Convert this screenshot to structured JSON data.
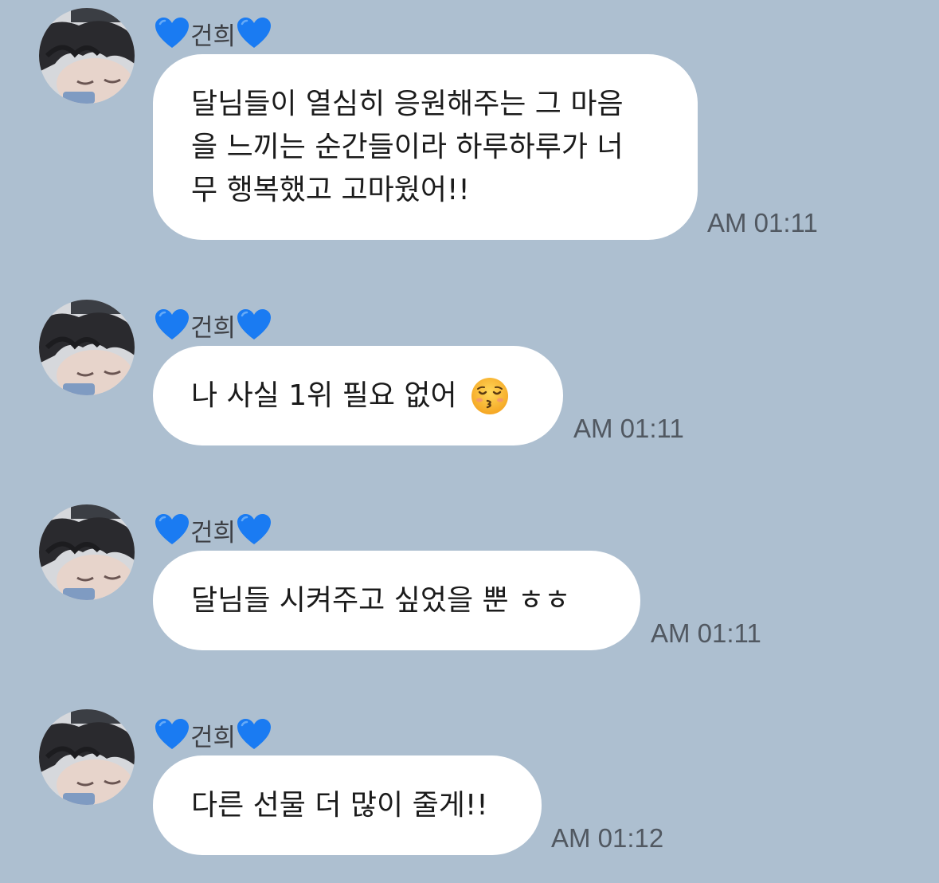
{
  "messages": [
    {
      "sender": "건희",
      "sender_icon": "blue-heart-emoji",
      "text": "달님들이 열심히 응원해주는 그 마음\n을 느끼는 순간들이라 하루하루가 너\n무 행복했고 고마웠어!!",
      "time": "AM 01:11"
    },
    {
      "sender": "건희",
      "sender_icon": "blue-heart-emoji",
      "text": "나 사실 1위 필요 없어",
      "emoji": "kissing-face-with-closed-eyes-emoji",
      "time": "AM 01:11"
    },
    {
      "sender": "건희",
      "sender_icon": "blue-heart-emoji",
      "text": "달님들 시켜주고 싶었을 뿐 ㅎㅎ",
      "time": "AM 01:11"
    },
    {
      "sender": "건희",
      "sender_icon": "blue-heart-emoji",
      "text": "다른 선물 더 많이 줄게!!",
      "time": "AM 01:12"
    }
  ],
  "colors": {
    "background": "#adbfd0",
    "bubble": "#ffffff",
    "heart": "#1a7bf2",
    "time_text": "#515861"
  }
}
